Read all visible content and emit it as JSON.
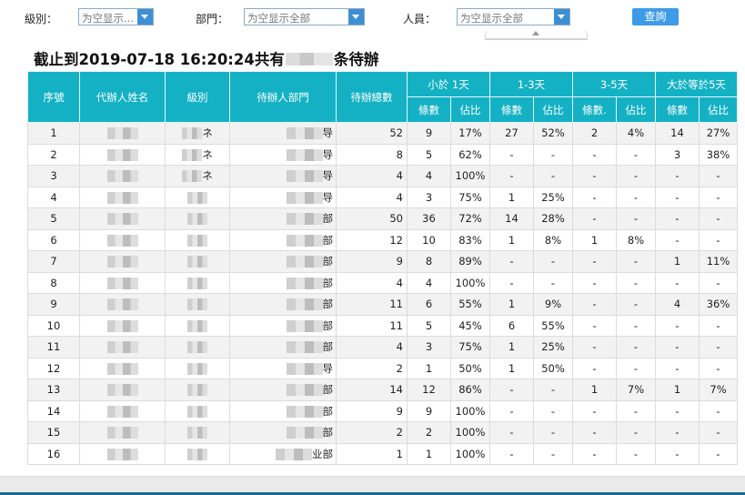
{
  "filters": {
    "level": {
      "label": "級別：",
      "value": "为空显示..."
    },
    "department": {
      "label": "部門：",
      "value": "为空显示全部"
    },
    "person": {
      "label": "人員：",
      "value": "为空显示全部"
    },
    "query_label": "查詢"
  },
  "title": {
    "prefix": "截止到2019-07-18 16:20:24共有",
    "suffix": "条待辦"
  },
  "table": {
    "headers": {
      "seq": "序號",
      "name": "代辦人姓名",
      "level": "級別",
      "dept": "待辦人部門",
      "total": "待辦總數",
      "g1": "小於 1天",
      "g2": "1-3天",
      "g3": "3-5天",
      "g4": "大於等於5天",
      "count": "條數",
      "count_alt": "條數.",
      "ratio": "佔比"
    },
    "rows": [
      {
        "seq": "1",
        "dept_tail": "导",
        "level_tail": "ネ",
        "total": "52",
        "c1": "9",
        "p1": "17%",
        "c2": "27",
        "p2": "52%",
        "c3": "2",
        "p3": "4%",
        "c4": "14",
        "p4": "27%"
      },
      {
        "seq": "2",
        "dept_tail": "导",
        "level_tail": "ネ",
        "total": "8",
        "c1": "5",
        "p1": "62%",
        "c2": "-",
        "p2": "-",
        "c3": "-",
        "p3": "-",
        "c4": "3",
        "p4": "38%"
      },
      {
        "seq": "3",
        "dept_tail": "导",
        "level_tail": "ネ",
        "total": "4",
        "c1": "4",
        "p1": "100%",
        "c2": "-",
        "p2": "-",
        "c3": "-",
        "p3": "-",
        "c4": "-",
        "p4": "-"
      },
      {
        "seq": "4",
        "dept_tail": "导",
        "level_tail": "",
        "total": "4",
        "c1": "3",
        "p1": "75%",
        "c2": "1",
        "p2": "25%",
        "c3": "-",
        "p3": "-",
        "c4": "-",
        "p4": "-"
      },
      {
        "seq": "5",
        "dept_tail": "部",
        "level_tail": "",
        "total": "50",
        "c1": "36",
        "p1": "72%",
        "c2": "14",
        "p2": "28%",
        "c3": "-",
        "p3": "-",
        "c4": "-",
        "p4": "-"
      },
      {
        "seq": "6",
        "dept_tail": "部",
        "level_tail": "",
        "total": "12",
        "c1": "10",
        "p1": "83%",
        "c2": "1",
        "p2": "8%",
        "c3": "1",
        "p3": "8%",
        "c4": "-",
        "p4": "-"
      },
      {
        "seq": "7",
        "dept_tail": "部",
        "level_tail": "",
        "total": "9",
        "c1": "8",
        "p1": "89%",
        "c2": "-",
        "p2": "-",
        "c3": "-",
        "p3": "-",
        "c4": "1",
        "p4": "11%"
      },
      {
        "seq": "8",
        "dept_tail": "部",
        "level_tail": "",
        "total": "4",
        "c1": "4",
        "p1": "100%",
        "c2": "-",
        "p2": "-",
        "c3": "-",
        "p3": "-",
        "c4": "-",
        "p4": "-"
      },
      {
        "seq": "9",
        "dept_tail": "部",
        "level_tail": "",
        "total": "11",
        "c1": "6",
        "p1": "55%",
        "c2": "1",
        "p2": "9%",
        "c3": "-",
        "p3": "-",
        "c4": "4",
        "p4": "36%"
      },
      {
        "seq": "10",
        "dept_tail": "部",
        "level_tail": "",
        "total": "11",
        "c1": "5",
        "p1": "45%",
        "c2": "6",
        "p2": "55%",
        "c3": "-",
        "p3": "-",
        "c4": "-",
        "p4": "-"
      },
      {
        "seq": "11",
        "dept_tail": "部",
        "level_tail": "",
        "total": "4",
        "c1": "3",
        "p1": "75%",
        "c2": "1",
        "p2": "25%",
        "c3": "-",
        "p3": "-",
        "c4": "-",
        "p4": "-"
      },
      {
        "seq": "12",
        "dept_tail": "导",
        "level_tail": "",
        "total": "2",
        "c1": "1",
        "p1": "50%",
        "c2": "1",
        "p2": "50%",
        "c3": "-",
        "p3": "-",
        "c4": "-",
        "p4": "-"
      },
      {
        "seq": "13",
        "dept_tail": "部",
        "level_tail": "",
        "total": "14",
        "c1": "12",
        "p1": "86%",
        "c2": "-",
        "p2": "-",
        "c3": "1",
        "p3": "7%",
        "c4": "1",
        "p4": "7%"
      },
      {
        "seq": "14",
        "dept_tail": "部",
        "level_tail": "",
        "total": "9",
        "c1": "9",
        "p1": "100%",
        "c2": "-",
        "p2": "-",
        "c3": "-",
        "p3": "-",
        "c4": "-",
        "p4": "-"
      },
      {
        "seq": "15",
        "dept_tail": "部",
        "level_tail": "",
        "total": "2",
        "c1": "2",
        "p1": "100%",
        "c2": "-",
        "p2": "-",
        "c3": "-",
        "p3": "-",
        "c4": "-",
        "p4": "-"
      },
      {
        "seq": "16",
        "dept_tail": "业部",
        "level_tail": "",
        "total": "1",
        "c1": "1",
        "p1": "100%",
        "c2": "-",
        "p2": "-",
        "c3": "-",
        "p3": "-",
        "c4": "-",
        "p4": "-"
      }
    ]
  },
  "colors": {
    "header_bg": "#14b1c4",
    "button_bg": "#3d9be9",
    "select_arrow": "#3d8fd4"
  }
}
